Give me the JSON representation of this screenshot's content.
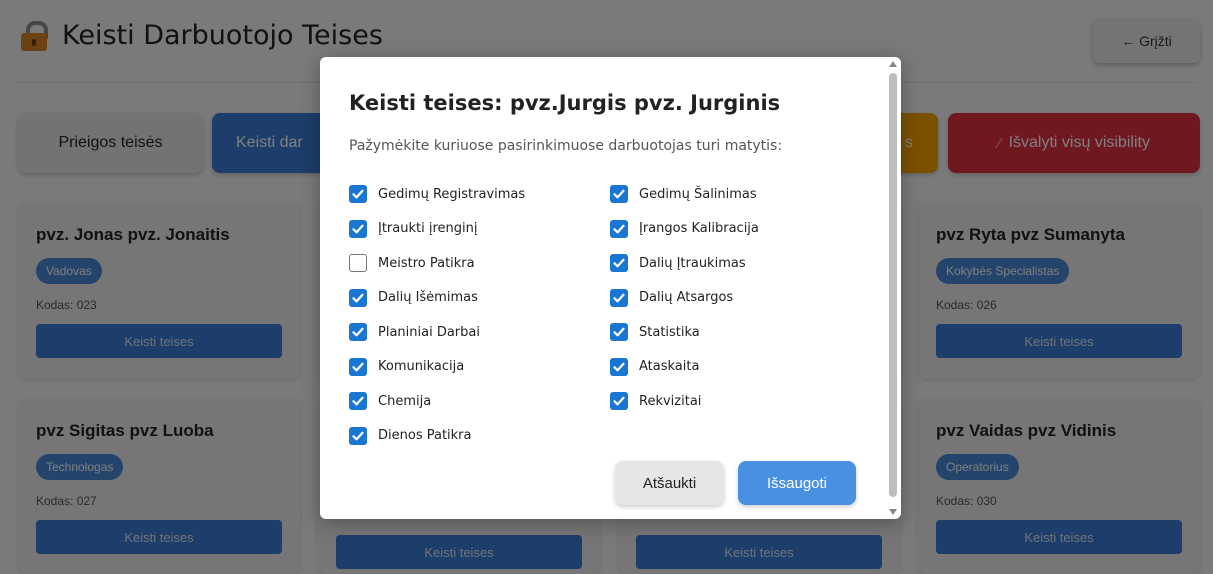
{
  "header": {
    "title": "Keisti Darbuotojo Teises",
    "back_label": "← Grįžti"
  },
  "tabs": {
    "prieigos": "Prieigos teisės",
    "keisti_partial": "Keisti dar",
    "orange_partial": "s",
    "clear_label": "Išvalyti visų visibility"
  },
  "cards": [
    {
      "name": "pvz. Jonas pvz. Jonaitis",
      "role": "Vadovas",
      "code": "Kodas: 023",
      "button": "Keisti teises"
    },
    {
      "name": "pvz Ryta pvz Sumanyta",
      "role": "Kokybės Specialistas",
      "code": "Kodas: 026",
      "button": "Keisti teises"
    },
    {
      "name": "pvz Sigitas pvz Luoba",
      "role": "Technologas",
      "code": "Kodas: 027",
      "button": "Keisti teises"
    },
    {
      "name": "pvz Vaidas pvz Vidinis",
      "role": "Operatorius",
      "code": "Kodas: 030",
      "button": "Keisti teises"
    },
    {
      "button": "Keisti teises"
    },
    {
      "button": "Keisti teises"
    }
  ],
  "modal": {
    "title": "Keisti teises: pvz.Jurgis pvz. Jurginis",
    "subtitle": "Pažymėkite kuriuose pasirinkimuose darbuotojas turi matytis:",
    "col1": [
      {
        "label": "Gedimų Registravimas",
        "checked": true
      },
      {
        "label": "Įtraukti įrenginį",
        "checked": true
      },
      {
        "label": "Meistro Patikra",
        "checked": false
      },
      {
        "label": "Dalių Išėmimas",
        "checked": true
      },
      {
        "label": "Planiniai Darbai",
        "checked": true
      },
      {
        "label": "Komunikacija",
        "checked": true
      },
      {
        "label": "Chemija",
        "checked": true
      },
      {
        "label": "Dienos Patikra",
        "checked": true
      }
    ],
    "col2": [
      {
        "label": "Gedimų Šalinimas",
        "checked": true
      },
      {
        "label": "Įrangos Kalibracija",
        "checked": true
      },
      {
        "label": "Dalių Įtraukimas",
        "checked": true
      },
      {
        "label": "Dalių Atsargos",
        "checked": true
      },
      {
        "label": "Statistika",
        "checked": true
      },
      {
        "label": "Ataskaita",
        "checked": true
      },
      {
        "label": "Rekvizitai",
        "checked": true
      }
    ],
    "cancel_label": "Atšaukti",
    "save_label": "Išsaugoti"
  },
  "colors": {
    "primary": "#3a7bd5",
    "warning": "#f4a300",
    "danger": "#e0303f",
    "checkbox": "#1976d2",
    "save": "#4a90e2"
  },
  "icons": {
    "header": "lock-icon",
    "clear": "broom-icon",
    "check": "check-icon"
  }
}
